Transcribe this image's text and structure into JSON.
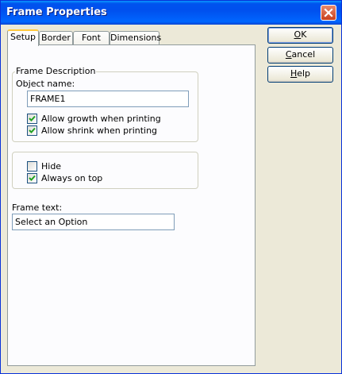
{
  "window": {
    "title": "Frame Properties"
  },
  "tabs": [
    {
      "label": "Setup",
      "active": true
    },
    {
      "label": "Border",
      "active": false
    },
    {
      "label": "Font",
      "active": false
    },
    {
      "label": "Dimensions",
      "active": false
    }
  ],
  "frame_description": {
    "legend": "Frame Description",
    "object_name_label": "Object name:",
    "object_name_value": "FRAME1",
    "allow_growth": {
      "label": "Allow growth when printing",
      "checked": true
    },
    "allow_shrink": {
      "label": "Allow shrink when printing",
      "checked": true
    }
  },
  "visibility": {
    "hide": {
      "label": "Hide",
      "checked": false
    },
    "always_on_top": {
      "label": "Always on top",
      "checked": true
    }
  },
  "frame_text": {
    "label": "Frame text:",
    "value": "Select an Option"
  },
  "buttons": {
    "ok": {
      "mnemonic": "O",
      "rest": "K"
    },
    "cancel": {
      "mnemonic": "C",
      "rest": "ancel"
    },
    "help": {
      "mnemonic": "H",
      "rest": "elp"
    }
  },
  "colors": {
    "title_bar": "#0054e3",
    "close_button": "#c8401d",
    "active_tab_highlight": "#ffc83c",
    "checkmark": "#21a121"
  }
}
